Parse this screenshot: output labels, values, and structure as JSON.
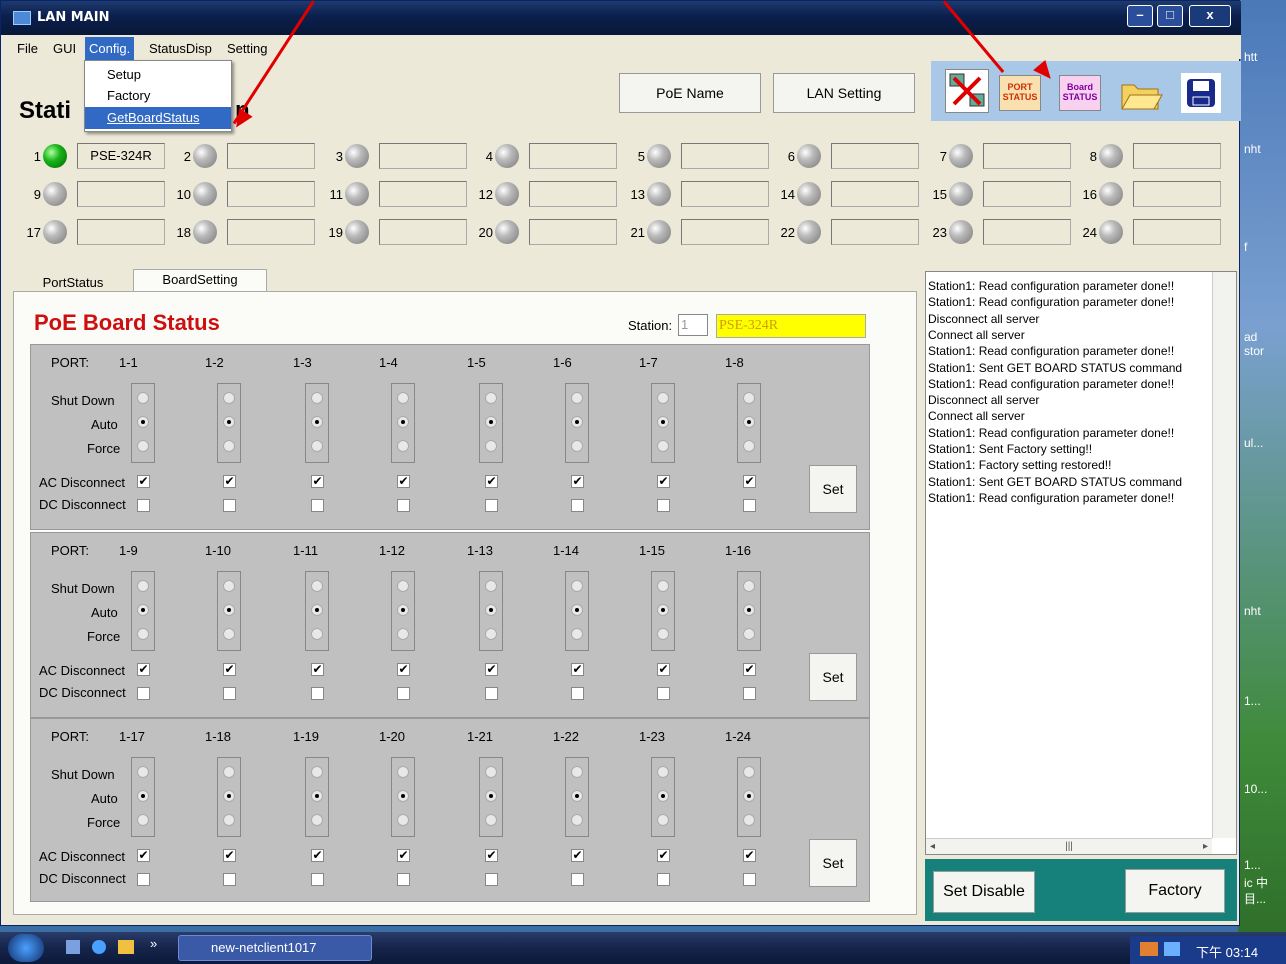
{
  "window": {
    "title": "LAN MAIN",
    "controls": [
      "–",
      "□",
      "x"
    ]
  },
  "menu": [
    "File",
    "GUI",
    "Config.",
    "StatusDisp",
    "Setting"
  ],
  "config_menu": [
    "Setup",
    "Factory",
    "GetBoardStatus"
  ],
  "station_title": "Stati",
  "station_title_end": "n",
  "buttons": {
    "poe_name": "PoE Name",
    "lan_setting": "LAN Setting",
    "set_disable": "Set Disable",
    "factory": "Factory",
    "set": "Set"
  },
  "toolbar": {
    "port_status": [
      "PORT",
      "STATUS"
    ],
    "board_status": [
      "Board",
      "STATUS"
    ]
  },
  "stations": [
    {
      "n": "1",
      "name": "PSE-324R",
      "on": true
    },
    {
      "n": "2",
      "name": "",
      "on": false
    },
    {
      "n": "3",
      "name": "",
      "on": false
    },
    {
      "n": "4",
      "name": "",
      "on": false
    },
    {
      "n": "5",
      "name": "",
      "on": false
    },
    {
      "n": "6",
      "name": "",
      "on": false
    },
    {
      "n": "7",
      "name": "",
      "on": false
    },
    {
      "n": "8",
      "name": "",
      "on": false
    },
    {
      "n": "9",
      "name": "",
      "on": false
    },
    {
      "n": "10",
      "name": "",
      "on": false
    },
    {
      "n": "11",
      "name": "",
      "on": false
    },
    {
      "n": "12",
      "name": "",
      "on": false
    },
    {
      "n": "13",
      "name": "",
      "on": false
    },
    {
      "n": "14",
      "name": "",
      "on": false
    },
    {
      "n": "15",
      "name": "",
      "on": false
    },
    {
      "n": "16",
      "name": "",
      "on": false
    },
    {
      "n": "17",
      "name": "",
      "on": false
    },
    {
      "n": "18",
      "name": "",
      "on": false
    },
    {
      "n": "19",
      "name": "",
      "on": false
    },
    {
      "n": "20",
      "name": "",
      "on": false
    },
    {
      "n": "21",
      "name": "",
      "on": false
    },
    {
      "n": "22",
      "name": "",
      "on": false
    },
    {
      "n": "23",
      "name": "",
      "on": false
    },
    {
      "n": "24",
      "name": "",
      "on": false
    }
  ],
  "tabs": [
    "PortStatus",
    "BoardSetting"
  ],
  "board": {
    "heading": "PoE Board Status",
    "station_label": "Station:",
    "station_value": "1",
    "station_name": "PSE-324R",
    "labels": {
      "port": "PORT:",
      "shut_down": "Shut Down",
      "auto": "Auto",
      "force": "Force",
      "ac": "AC Disconnect",
      "dc": "DC Disconnect"
    },
    "groups": [
      {
        "ports": [
          "1-1",
          "1-2",
          "1-3",
          "1-4",
          "1-5",
          "1-6",
          "1-7",
          "1-8"
        ]
      },
      {
        "ports": [
          "1-9",
          "1-10",
          "1-11",
          "1-12",
          "1-13",
          "1-14",
          "1-15",
          "1-16"
        ]
      },
      {
        "ports": [
          "1-17",
          "1-18",
          "1-19",
          "1-20",
          "1-21",
          "1-22",
          "1-23",
          "1-24"
        ]
      }
    ],
    "mode": "Auto",
    "ac_checked": true,
    "dc_checked": false
  },
  "log": [
    "Station1: Read configuration parameter done!!",
    "Station1: Read configuration parameter done!!",
    "Disconnect all server",
    "Connect all server",
    "Station1: Read configuration parameter done!!",
    "Station1: Sent GET BOARD STATUS command",
    "Station1: Read configuration parameter done!!",
    "Disconnect all server",
    "Connect all server",
    "Station1: Read configuration parameter done!!",
    "Station1: Sent Factory setting!!",
    "Station1: Factory setting restored!!",
    "Station1: Sent GET BOARD STATUS command",
    "Station1: Read configuration parameter done!!"
  ],
  "taskbar": {
    "task": "new-netclient1017",
    "clock": "下午 03:14",
    "chevron": "»"
  },
  "desktop_labels": [
    "htt",
    "nht",
    "f",
    "ad",
    "stor",
    "ul...",
    "nht",
    "1...",
    "10...",
    "1...",
    "ic 中",
    "目..."
  ],
  "colors": {
    "accent_red": "#cc1010",
    "highlight": "#316ac5",
    "station_name_bg": "#ffff00",
    "teal": "#16807a"
  }
}
